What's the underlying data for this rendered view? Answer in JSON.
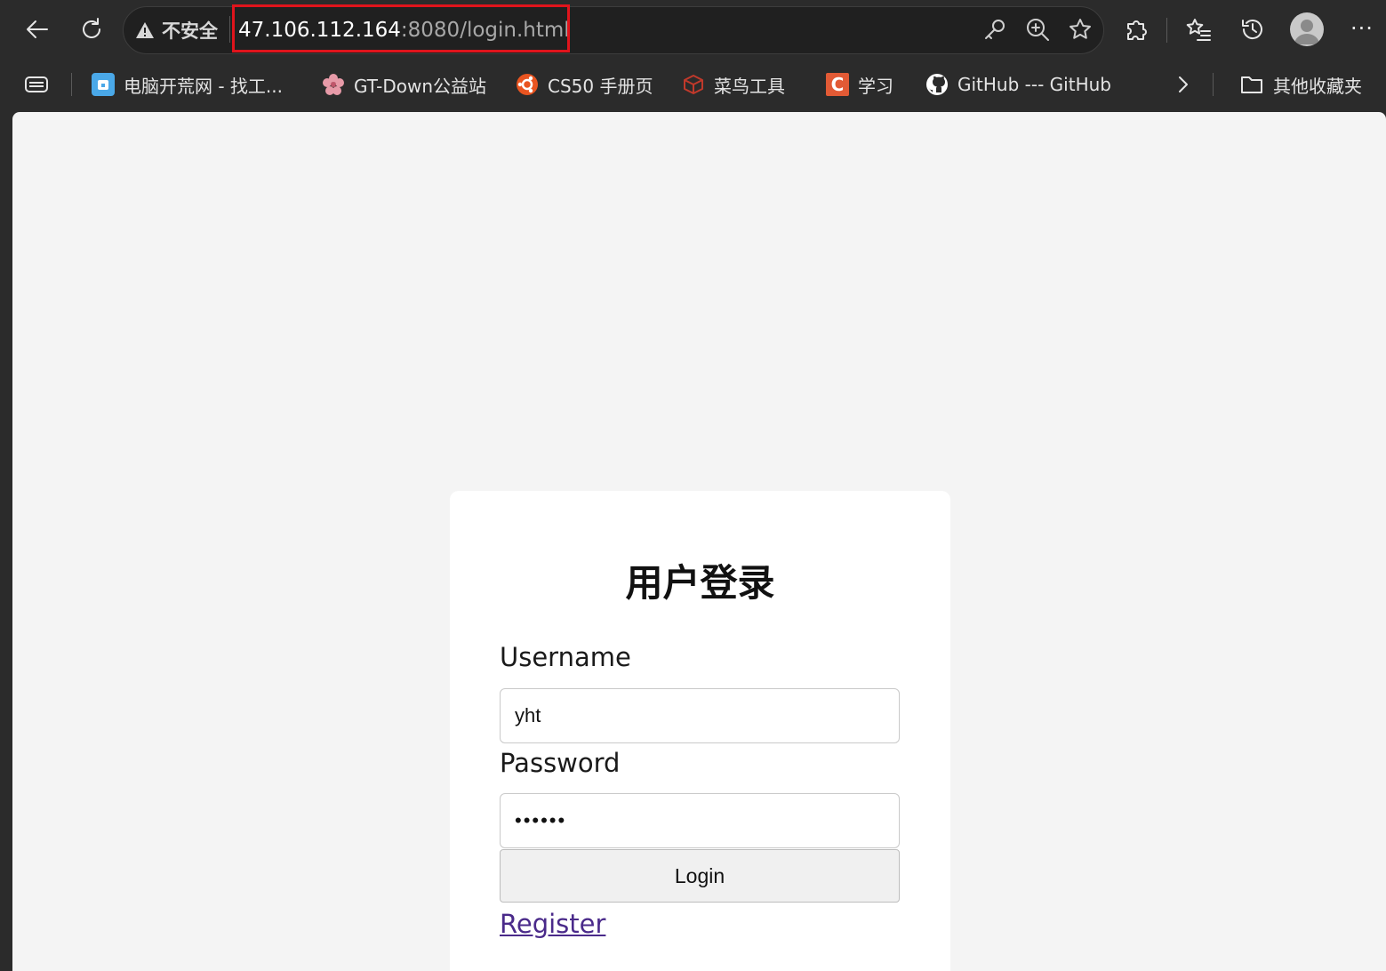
{
  "browser": {
    "security_label": "不安全",
    "url_host": "47.106.112.164",
    "url_rest": ":8080/login.html",
    "highlight_color": "#e0141c",
    "more_label": "···"
  },
  "bookmarks": [
    {
      "label": "电脑开荒网 - 找工...",
      "icon": "bookmark-app-icon",
      "color": "#4aa8e8"
    },
    {
      "label": "GT-Down公益站",
      "icon": "flower-icon",
      "color": "#e79aa8"
    },
    {
      "label": "CS50 手册页",
      "icon": "ubuntu-icon",
      "color": "#e95420"
    },
    {
      "label": "菜鸟工具",
      "icon": "cube-icon",
      "color": "#c0392b"
    },
    {
      "label": "学习",
      "icon": "c-letter-icon",
      "color": "#e25a35",
      "glyph": "C"
    },
    {
      "label": "GitHub --- GitHub",
      "icon": "github-icon",
      "color": "#ffffff"
    }
  ],
  "other_bookmarks_label": "其他收藏夹",
  "login": {
    "title": "用户登录",
    "username_label": "Username",
    "username_value": "yht",
    "password_label": "Password",
    "password_value": "••••••",
    "login_button": "Login",
    "register_link": "Register"
  }
}
